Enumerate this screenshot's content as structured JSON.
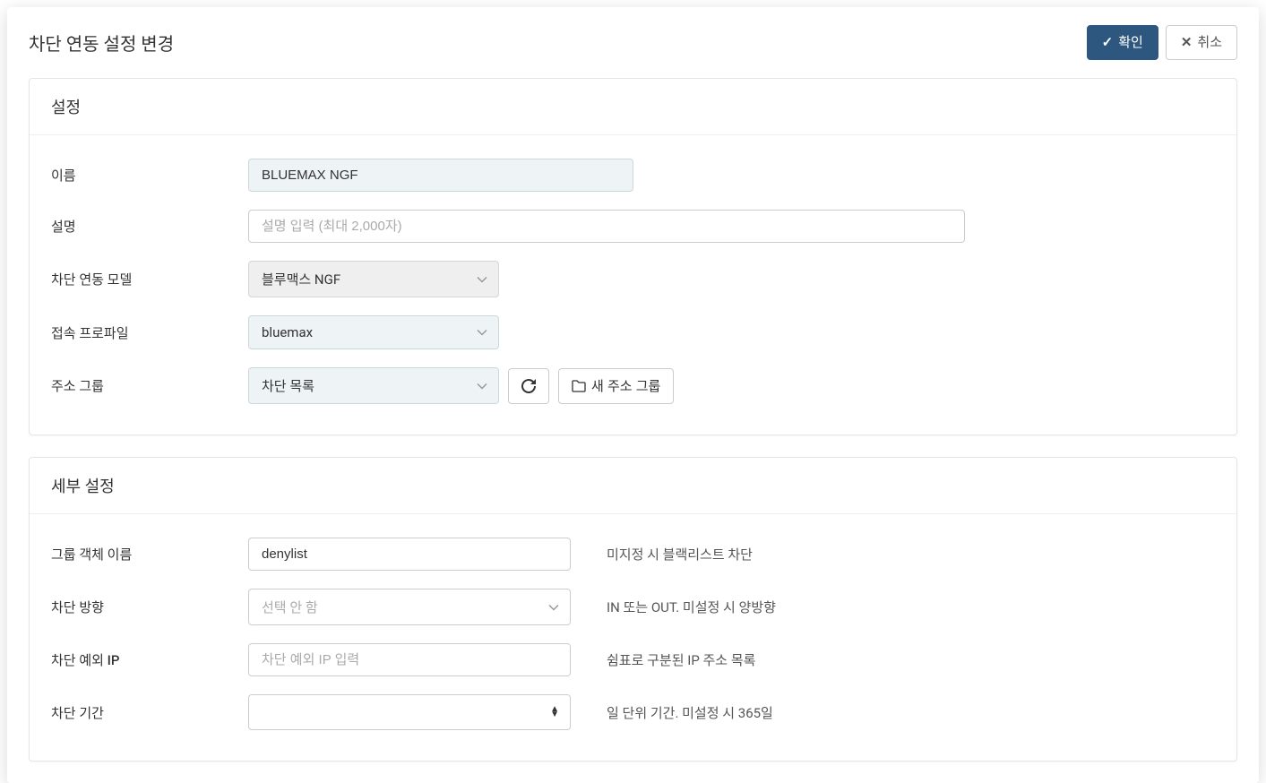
{
  "header": {
    "title": "차단 연동 설정 변경",
    "confirm_label": "확인",
    "cancel_label": "취소"
  },
  "settings_panel": {
    "title": "설정",
    "name": {
      "label": "이름",
      "value": "BLUEMAX NGF"
    },
    "description": {
      "label": "설명",
      "value": "",
      "placeholder": "설명 입력 (최대 2,000자)"
    },
    "model": {
      "label": "차단 연동 모델",
      "value": "블루맥스 NGF"
    },
    "profile": {
      "label": "접속 프로파일",
      "value": "bluemax"
    },
    "address_group": {
      "label": "주소 그룹",
      "value": "차단 목록",
      "new_button_label": "새 주소 그룹"
    }
  },
  "detail_panel": {
    "title": "세부 설정",
    "group_object_name": {
      "label": "그룹 객체 이름",
      "value": "denylist",
      "hint": "미지정 시 블랙리스트 차단"
    },
    "block_direction": {
      "label": "차단 방향",
      "placeholder": "선택 안 함",
      "hint": "IN 또는 OUT. 미설정 시 양방향"
    },
    "exception_ip": {
      "label": "차단 예외 IP",
      "value": "",
      "placeholder": "차단 예외 IP 입력",
      "hint": "쉼표로 구분된 IP 주소 목록"
    },
    "block_period": {
      "label": "차단 기간",
      "value": "",
      "hint": "일 단위 기간. 미설정 시 365일"
    }
  }
}
